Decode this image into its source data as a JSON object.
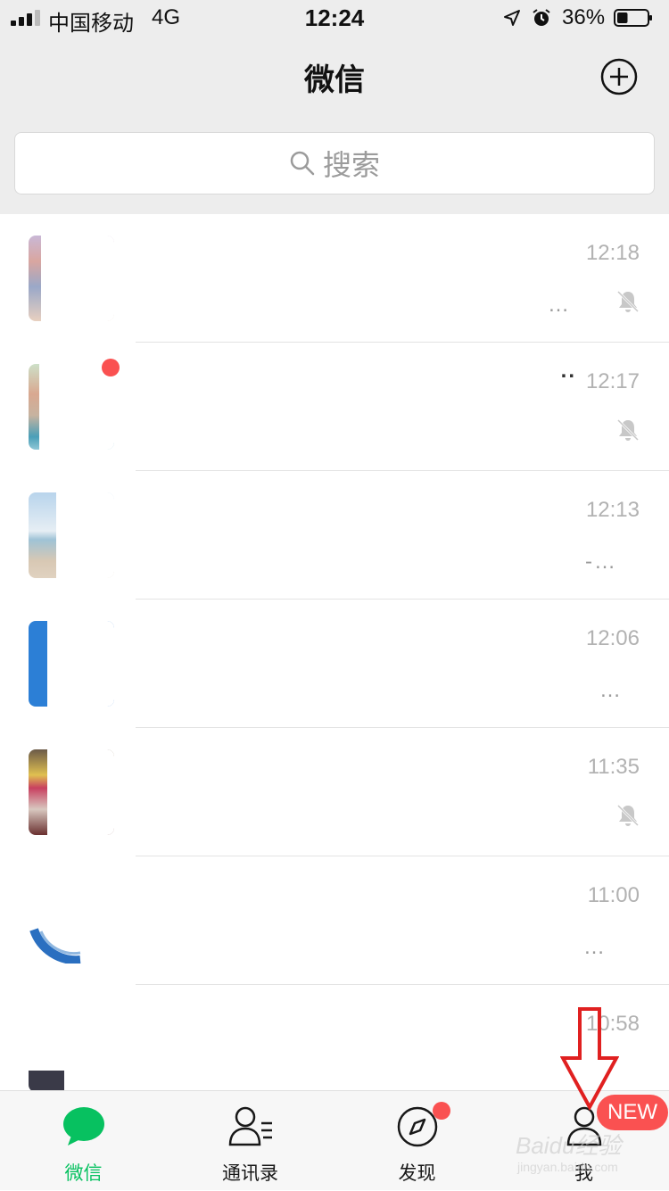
{
  "status_bar": {
    "carrier": "中国移动",
    "network": "4G",
    "time": "12:24",
    "battery": "36%",
    "battery_level": 0.36
  },
  "header": {
    "title": "微信",
    "add_icon": "plus-circle-icon"
  },
  "search": {
    "placeholder": "搜索"
  },
  "chats": [
    {
      "time": "12:18",
      "preview": "…",
      "muted": true,
      "unread_dot": false
    },
    {
      "time": "12:17",
      "preview": "..",
      "muted": true,
      "unread_dot": true
    },
    {
      "time": "12:13",
      "preview": "-…",
      "muted": false,
      "unread_dot": false
    },
    {
      "time": "12:06",
      "preview": "…",
      "muted": false,
      "unread_dot": false
    },
    {
      "time": "11:35",
      "preview": "",
      "muted": true,
      "unread_dot": false
    },
    {
      "time": "11:00",
      "preview": "…",
      "muted": false,
      "unread_dot": false
    },
    {
      "time": "10:58",
      "preview": "",
      "muted": false,
      "unread_dot": false
    }
  ],
  "tabs": [
    {
      "label": "微信",
      "icon": "chat-bubble-icon",
      "active": true
    },
    {
      "label": "通讯录",
      "icon": "contacts-icon",
      "active": false
    },
    {
      "label": "发现",
      "icon": "compass-icon",
      "active": false
    },
    {
      "label": "我",
      "icon": "person-icon",
      "active": false
    }
  ],
  "badges": {
    "me_new": "NEW"
  },
  "watermark": {
    "text": "Baidu经验",
    "url": "jingyan.baidu.com"
  },
  "colors": {
    "accent": "#07c160",
    "badge": "#fa5151",
    "header_bg": "#ededed"
  }
}
